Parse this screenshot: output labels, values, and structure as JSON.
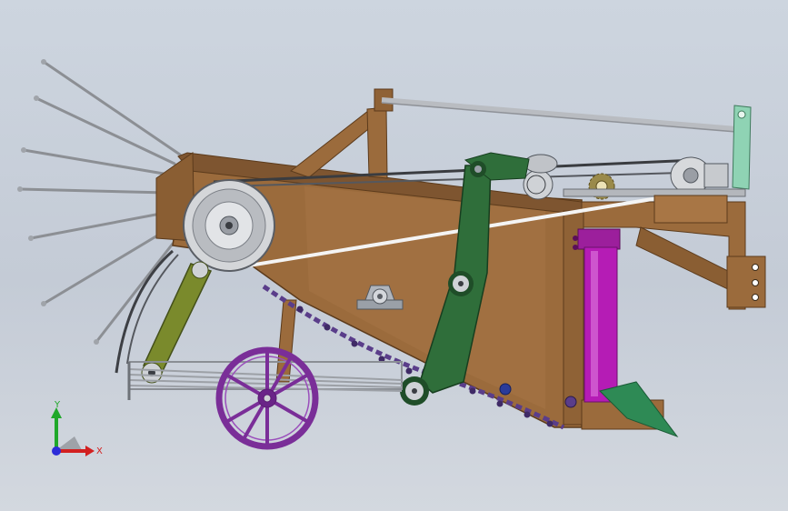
{
  "viewport": {
    "background_top": "#cdd5df",
    "background_bottom": "#d3d8df"
  },
  "triad": {
    "x_label": "X",
    "y_label": "Y",
    "x_color": "#d22020",
    "y_color": "#1fa82a",
    "z_color": "#2c2cd8"
  },
  "colors": {
    "frame": "#9b6b3c",
    "frame_dark": "#6e4a26",
    "arm_green": "#2f6e3a",
    "arm_olive": "#7a8a2c",
    "wheel_purple": "#7a2e98",
    "cylinder_magenta": "#b51cb5",
    "chain": "#5a3d8a",
    "pulley": "#cfd2d6",
    "rod": "#c9cbcf",
    "blade_green": "#2e8a55",
    "bracket_mint": "#8fd3b4"
  }
}
